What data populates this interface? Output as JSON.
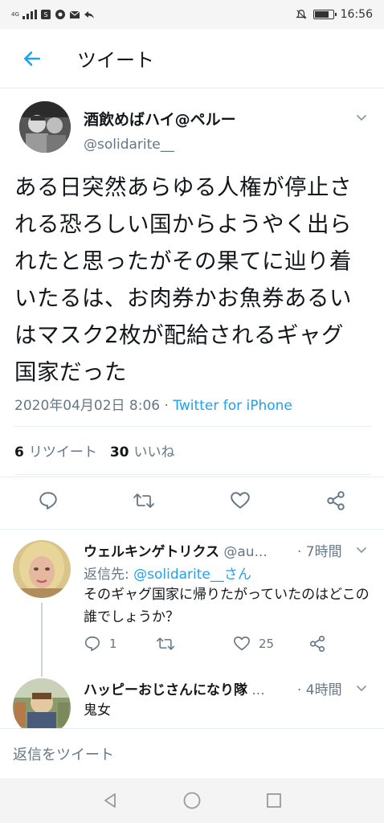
{
  "status_bar": {
    "network": "4G",
    "time": "16:56"
  },
  "header": {
    "title": "ツイート"
  },
  "tweet": {
    "author_name": "酒飲めばハイ@ペルー",
    "author_handle": "@solidarite__",
    "text": "ある日突然あらゆる人権が停止さ\nれる恐ろしい国からようやく出ら\nれたと思ったがその果てに辿り着\nいたるは、お肉券かお魚券あるい\nはマスク2枚が配給されるギャグ\n国家だった",
    "timestamp": "2020年04月02日 8:06",
    "separator": " · ",
    "via": "Twitter for iPhone",
    "retweet_count": "6",
    "retweet_label": "リツイート",
    "like_count": "30",
    "like_label": "いいね"
  },
  "replies": [
    {
      "name": "ウェルキンゲトリクス",
      "handle": "@au...",
      "time": "· 7時間",
      "reply_to_label": "返信先: ",
      "reply_to_mention": "@solidarite__さん",
      "text": "そのギャグ国家に帰りたがっていたのはどこの誰でしょうか？",
      "reply_count": "1",
      "like_count": "25"
    },
    {
      "name": "ハッピーおじさんになり隊",
      "handle": "...",
      "time": "· 4時間",
      "text": "鬼女"
    }
  ],
  "compose": {
    "placeholder": "返信をツイート"
  },
  "colors": {
    "accent": "#1da1f2",
    "muted": "#657786",
    "text": "#14171a",
    "divider": "#e6ecf0"
  },
  "icons": {
    "back": "arrow-left-icon",
    "reply": "speech-bubble-icon",
    "retweet": "retweet-icon",
    "like": "heart-icon",
    "share": "share-icon",
    "caret": "chevron-down-icon",
    "nav_back": "triangle-back-icon",
    "nav_home": "circle-home-icon",
    "nav_recent": "square-recent-icon"
  }
}
